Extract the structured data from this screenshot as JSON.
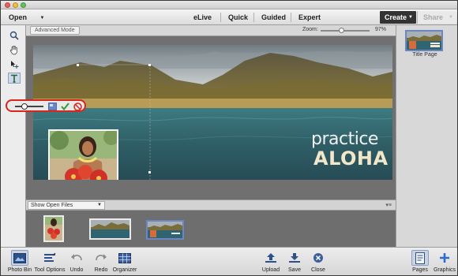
{
  "topbar": {
    "open_label": "Open",
    "modes": [
      "eLive",
      "Quick",
      "Guided",
      "Expert"
    ],
    "create_label": "Create",
    "share_label": "Share"
  },
  "toolbox": {
    "tools": [
      "zoom-tool",
      "hand-tool",
      "move-tool",
      "type-tool"
    ]
  },
  "options_bar": {
    "advanced_mode_label": "Advanced Mode",
    "zoom_label": "Zoom:",
    "zoom_value": "97%",
    "zoom_fraction": 0.42
  },
  "canvas": {
    "text_line1": "practice",
    "text_line2": "ALOHA"
  },
  "rotate_control": {
    "slider_fraction": 0.3,
    "buttons": [
      "crop-image-icon",
      "commit-check-icon",
      "cancel-icon"
    ]
  },
  "right_panel": {
    "page_label": "Title Page"
  },
  "photo_bin": {
    "selector_label": "Show Open Files",
    "thumbs": [
      "hula-dancer",
      "mountain-ocean",
      "title-page"
    ]
  },
  "taskbar": {
    "photo_bin": "Photo Bin",
    "tool_options": "Tool Options",
    "undo": "Undo",
    "redo": "Redo",
    "organizer": "Organizer",
    "upload": "Upload",
    "save": "Save",
    "close": "Close",
    "pages": "Pages",
    "graphics": "Graphics"
  },
  "colors": {
    "accent_red": "#d7261e",
    "selection_blue": "#6c86c4",
    "aloha_text": "#f3e7c9",
    "create_bg": "#333333"
  }
}
